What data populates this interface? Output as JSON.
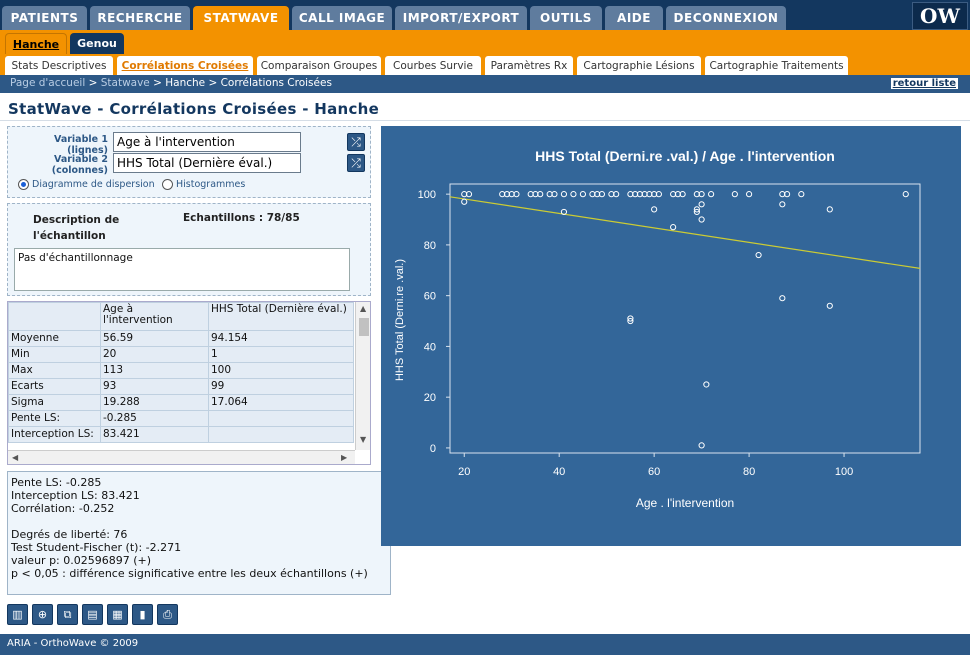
{
  "topnav": {
    "tabs": [
      "PATIENTS",
      "RECHERCHE",
      "STATWAVE",
      "CALL IMAGE",
      "IMPORT/EXPORT",
      "OUTILS",
      "AIDE",
      "DECONNEXION"
    ],
    "active": "STATWAVE",
    "logo": "OW"
  },
  "subnav": {
    "tabs": [
      "Hanche",
      "Genou"
    ],
    "active": "Hanche"
  },
  "thirdnav": {
    "tabs": [
      "Stats Descriptives",
      "Corrélations Croisées",
      "Comparaison Groupes",
      "Courbes Survie",
      "Paramètres Rx",
      "Cartographie Lésions",
      "Cartographie Traitements"
    ],
    "active": "Corrélations Croisées"
  },
  "breadcrumb": {
    "home": "Page d'accueil",
    "statwave": "Statwave",
    "rest": " > Hanche > Corrélations Croisées",
    "sep": " > ",
    "back": "retour liste"
  },
  "page_title": "StatWave - Corrélations Croisées - Hanche",
  "variables": {
    "var1_label": "Variable 1 (lignes)",
    "var1_value": "Age à l'intervention",
    "var2_label_a": "Variable 2",
    "var2_label_b": "(colonnes)",
    "var2_value": "HHS Total (Dernière éval.)",
    "radio_scatter": "Diagramme de dispersion",
    "radio_hist": "Histogrammes",
    "selected": "Diagramme de dispersion"
  },
  "description": {
    "label_a": "Description de",
    "label_b": "l'échantillon",
    "samples": "Echantillons : 78/85",
    "text": "Pas d'échantillonnage"
  },
  "stats": {
    "headers": [
      "",
      "Age à l'intervention",
      "HHS Total (Dernière éval.)"
    ],
    "rows": [
      [
        "Moyenne",
        "56.59",
        "94.154"
      ],
      [
        "Min",
        "20",
        "1"
      ],
      [
        "Max",
        "113",
        "100"
      ],
      [
        "Ecarts",
        "93",
        "99"
      ],
      [
        "Sigma",
        "19.288",
        "17.064"
      ],
      [
        "Pente LS:",
        "-0.285",
        ""
      ],
      [
        "Interception LS:",
        "83.421",
        ""
      ]
    ]
  },
  "results": {
    "pente": "Pente LS: -0.285",
    "intercept": "Interception LS: 83.421",
    "correlation": "Corrélation: -0.252",
    "ddl": "Degrés de liberté: 76",
    "test": "Test Student-Fischer (t): -2.271",
    "pvalue": "valeur p: 0.02596897 (+)",
    "conclusion": "p < 0,05 : différence significative entre les deux échantillons (+)"
  },
  "toolbar": {
    "icons": [
      "bar-chart-icon",
      "zoom-icon",
      "export-icon",
      "clipboard-icon",
      "table-export-icon",
      "chart-export-icon",
      "print-icon"
    ]
  },
  "footer": "ARIA - OrthoWave © 2009",
  "colors": {
    "nav": "#13375f",
    "accent": "#f39200",
    "chart_bg": "#336699",
    "regression": "#cccc33"
  },
  "chart_data": {
    "type": "scatter",
    "title": "HHS Total (Derni.re .val.) / Age . l'intervention",
    "xlabel": "Age . l'intervention",
    "ylabel": "HHS Total (Derni.re .val.)",
    "xlim": [
      17,
      116
    ],
    "ylim": [
      -2,
      104
    ],
    "xticks": [
      "20",
      "40",
      "60",
      "80",
      "100"
    ],
    "yticks": [
      "0",
      "20",
      "40",
      "60",
      "80",
      "100"
    ],
    "grid": false,
    "regression": {
      "slope": -0.285,
      "intercept": 103.8
    },
    "points": [
      [
        20,
        100
      ],
      [
        20,
        97
      ],
      [
        21,
        100
      ],
      [
        28,
        100
      ],
      [
        29,
        100
      ],
      [
        30,
        100
      ],
      [
        31,
        100
      ],
      [
        34,
        100
      ],
      [
        35,
        100
      ],
      [
        36,
        100
      ],
      [
        38,
        100
      ],
      [
        39,
        100
      ],
      [
        41,
        100
      ],
      [
        41,
        93
      ],
      [
        43,
        100
      ],
      [
        45,
        100
      ],
      [
        47,
        100
      ],
      [
        48,
        100
      ],
      [
        49,
        100
      ],
      [
        51,
        100
      ],
      [
        52,
        100
      ],
      [
        55,
        100
      ],
      [
        56,
        100
      ],
      [
        57,
        100
      ],
      [
        58,
        100
      ],
      [
        59,
        100
      ],
      [
        60,
        100
      ],
      [
        61,
        100
      ],
      [
        64,
        100
      ],
      [
        65,
        100
      ],
      [
        66,
        100
      ],
      [
        69,
        100
      ],
      [
        70,
        100
      ],
      [
        72,
        100
      ],
      [
        77,
        100
      ],
      [
        80,
        100
      ],
      [
        87,
        100
      ],
      [
        88,
        100
      ],
      [
        91,
        100
      ],
      [
        113,
        100
      ],
      [
        55,
        51
      ],
      [
        55,
        50
      ],
      [
        60,
        94
      ],
      [
        64,
        87
      ],
      [
        69,
        94
      ],
      [
        69,
        93
      ],
      [
        70,
        96
      ],
      [
        70,
        90
      ],
      [
        71,
        25
      ],
      [
        70,
        1
      ],
      [
        82,
        76
      ],
      [
        87,
        96
      ],
      [
        87,
        59
      ],
      [
        97,
        94
      ],
      [
        97,
        56
      ]
    ]
  }
}
